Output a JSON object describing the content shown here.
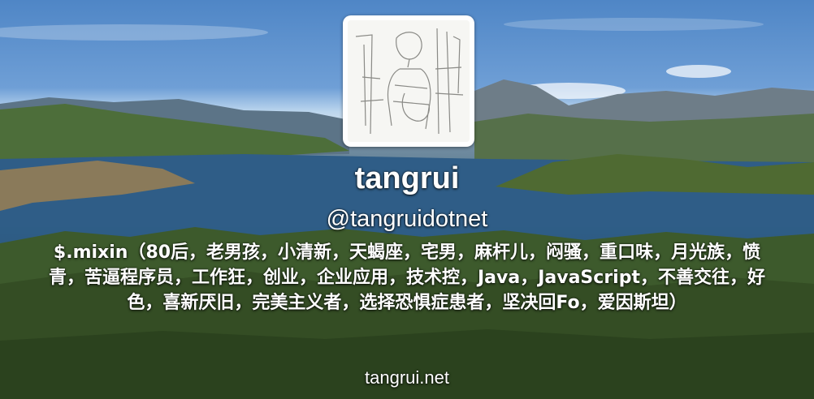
{
  "profile_header": {
    "display_name": "tangrui",
    "screen_name": "@tangruidotnet",
    "bio": "$.mixin（80后，老男孩，小清新，天蝎座，宅男，麻杆儿，闷骚，重口味，月光族，愤青，苦逼程序员，工作狂，创业，企业应用，技术控，Java，JavaScript，不善交往，好色，喜新厌旧，完美主义者，选择恐惧症患者，坚决回Fo，爱因斯坦）",
    "url": "tangrui.net",
    "avatar_icon": "sketch-portrait-avatar",
    "background": "lake-and-mountains-photo"
  },
  "colors": {
    "text": "#ffffff",
    "avatar_border": "#ffffff",
    "sky": "#5f93cf",
    "lake": "#2f5e88",
    "forest": "#2f4a25"
  }
}
